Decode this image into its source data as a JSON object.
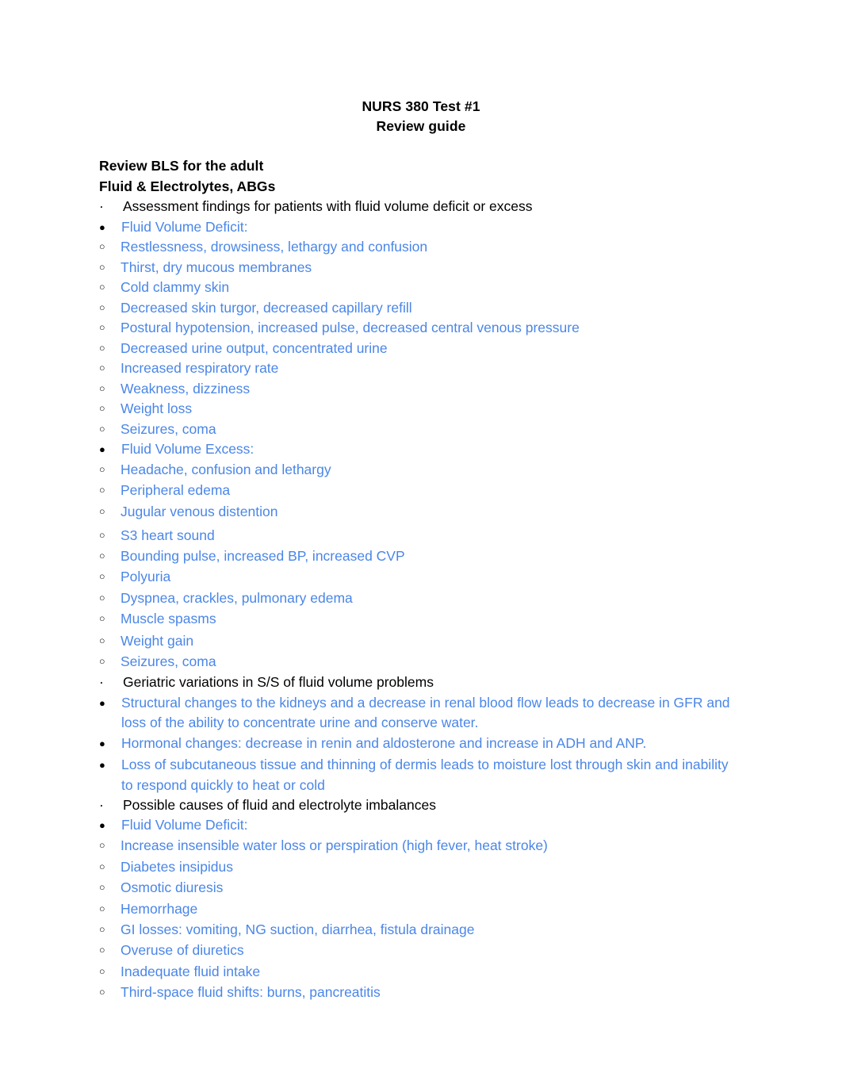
{
  "document": {
    "title_lines": [
      "NURS 380 Test #1",
      "Review guide"
    ],
    "headings": [
      "Review BLS for the adult",
      "Fluid & Electrolytes, ABGs"
    ],
    "markers": {
      "level1": "·",
      "level2": "●",
      "level3": "○"
    },
    "colors": {
      "text": "#000000",
      "accent_blue": "#4a86e8",
      "background": "#ffffff"
    },
    "sections": [
      {
        "topic": "Assessment findings for patients with fluid volume deficit or excess",
        "groups": [
          {
            "label": "Fluid Volume Deficit:",
            "items": [
              "Restlessness, drowsiness, lethargy and confusion",
              "Thirst, dry mucous membranes",
              "Cold clammy skin",
              "Decreased skin turgor, decreased capillary refill",
              "Postural hypotension, increased pulse, decreased central venous pressure",
              "Decreased urine output, concentrated urine",
              "Increased respiratory rate",
              "Weakness, dizziness",
              "Weight loss",
              "Seizures, coma"
            ]
          },
          {
            "label": "Fluid Volume Excess:",
            "items": [
              "Headache, confusion and lethargy",
              "Peripheral edema",
              "Jugular venous distention",
              "S3 heart sound",
              "Bounding pulse, increased BP, increased CVP",
              "Polyuria",
              "Dyspnea, crackles, pulmonary edema",
              "Muscle spasms",
              "Weight gain",
              "Seizures, coma"
            ]
          }
        ]
      },
      {
        "topic": "Geriatric variations in S/S of fluid volume problems",
        "bullets": [
          "Structural changes to the kidneys and a decrease in renal blood flow leads to decrease in GFR and loss of the ability to concentrate urine and conserve water.",
          "Hormonal changes: decrease in renin and aldosterone and increase in ADH and ANP.",
          "Loss of subcutaneous tissue and thinning of dermis leads to moisture lost through skin and inability to respond quickly to heat or cold"
        ]
      },
      {
        "topic": "Possible causes of fluid and electrolyte imbalances",
        "groups": [
          {
            "label": "Fluid Volume Deficit:",
            "items": [
              "Increase insensible water loss or perspiration (high fever, heat stroke)",
              "Diabetes insipidus",
              "Osmotic diuresis",
              "Hemorrhage",
              "GI losses: vomiting, NG suction, diarrhea, fistula drainage",
              "Overuse of diuretics",
              "Inadequate fluid intake",
              "Third-space fluid shifts: burns, pancreatitis"
            ]
          }
        ]
      }
    ]
  }
}
